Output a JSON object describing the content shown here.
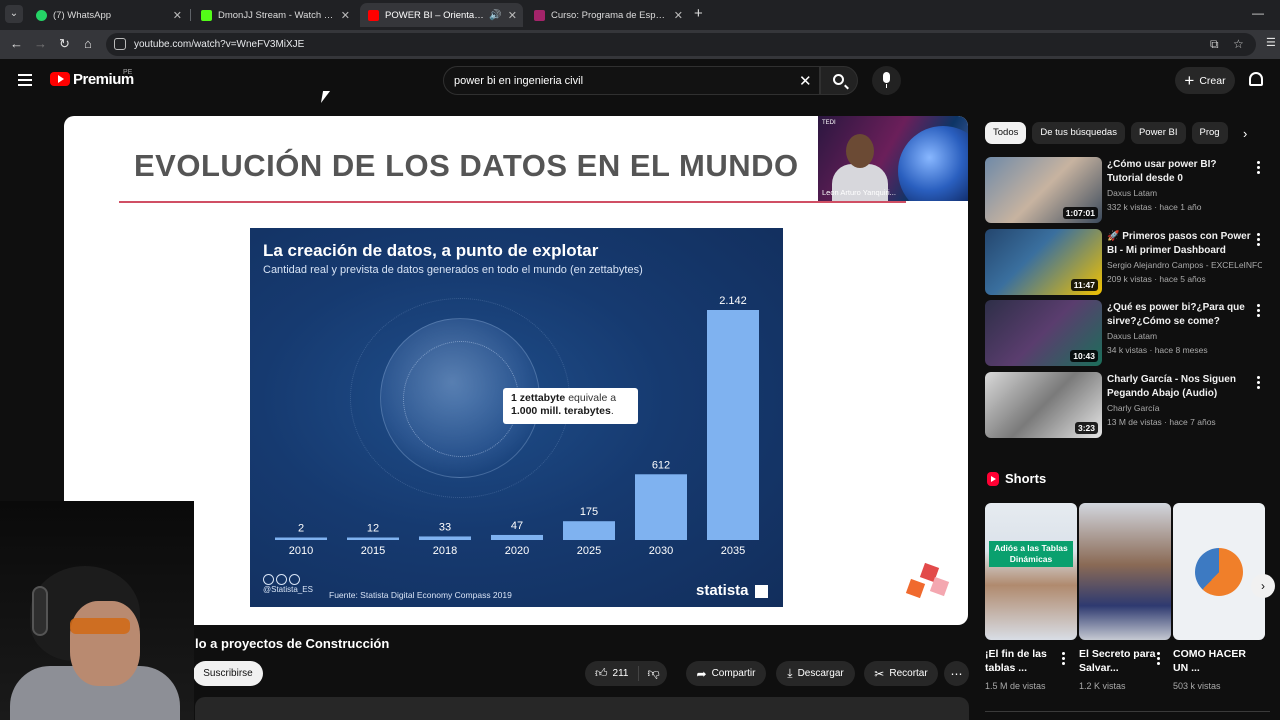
{
  "browser": {
    "tabs": [
      {
        "title": "(7) WhatsApp",
        "favicon_color": "#25d366"
      },
      {
        "title": "DmonJJ Stream - Watch Live on",
        "favicon_color": "#53fc18"
      },
      {
        "title": "POWER BI – Orientado a pro",
        "favicon_color": "#ff0000",
        "active": true
      },
      {
        "title": "Curso: Programa de Especializa",
        "favicon_color": "#a4246a"
      }
    ],
    "url": "youtube.com/watch?v=WneFV3MiXJE"
  },
  "masthead": {
    "logo_text": "Premium",
    "country_code": "PE",
    "search_query": "power bi en ingenieria civil",
    "create_label": "Crear"
  },
  "slide": {
    "title": "EVOLUCIÓN DE LOS DATOS EN EL MUNDO",
    "presenter_name": "Leon Arturo Yanquiri...",
    "presenter_tag": "TEDI"
  },
  "chart_data": {
    "type": "bar",
    "title": "La creación de datos, a punto de explotar",
    "subtitle": "Cantidad real y prevista de datos generados en todo el mundo (en zettabytes)",
    "categories": [
      "2010",
      "2015",
      "2018",
      "2020",
      "2025",
      "2030",
      "2035"
    ],
    "values": [
      2,
      12,
      33,
      47,
      175,
      612,
      2142
    ],
    "value_labels": [
      "2",
      "12",
      "33",
      "47",
      "175",
      "612",
      "2.142"
    ],
    "ylim": [
      0,
      2142
    ],
    "bar_color": "#7fb2f0",
    "grid": false,
    "annotation_bold_1": "1 zettabyte",
    "annotation_rest_1": " equivale a",
    "annotation_bold_2": "1.000 mill. terabytes",
    "annotation_rest_2": ".",
    "license": "@Statista_ES",
    "source": "Fuente: Statista Digital Economy Compass 2019",
    "brand": "statista"
  },
  "video": {
    "title_visible": "lo a proyectos de Construcción",
    "subscribe_label": "Suscribirse",
    "likes": "211",
    "share_label": "Compartir",
    "download_label": "Descargar",
    "clip_label": "Recortar"
  },
  "chips": [
    "Todos",
    "De tus búsquedas",
    "Power BI",
    "Prog"
  ],
  "recommendations": [
    {
      "title": "¿Cómo usar power BI? Tutorial desde 0",
      "channel": "Daxus Latam",
      "meta": "332 k vistas · hace 1 año",
      "duration": "1:07:01",
      "thumb_bg": "#5c6e8a"
    },
    {
      "title": "🚀 Primeros pasos con Power BI - Mi primer Dashboard",
      "channel": "Sergio Alejandro Campos - EXCELeINFO",
      "meta": "209 k vistas · hace 5 años",
      "duration": "11:47",
      "thumb_bg": "#1f3a5a"
    },
    {
      "title": "¿Qué es power bi?¿Para que sirve?¿Cómo se come?",
      "channel": "Daxus Latam",
      "meta": "34 k vistas · hace 8 meses",
      "duration": "10:43",
      "thumb_bg": "#3a3d56"
    },
    {
      "title": "Charly García - Nos Siguen Pegando Abajo (Audio)",
      "channel": "Charly García",
      "meta": "13 M de vistas · hace 7 años",
      "duration": "3:23",
      "thumb_bg": "#b4b4b4"
    }
  ],
  "shorts": {
    "label": "Shorts",
    "items": [
      {
        "title": "¡El fin de las tablas ...",
        "views": "1.5 M de vistas",
        "thumb_bg": "#dfe6ee",
        "overlay": "Adiós a las Tablas Dinámicas"
      },
      {
        "title": "El Secreto para Salvar...",
        "views": "1.2 K vistas",
        "thumb_bg": "#c8ccd6",
        "overlay": ""
      },
      {
        "title": "COMO HACER UN ...",
        "views": "503 k vistas",
        "thumb_bg": "#eef1f4",
        "overlay": ""
      }
    ]
  }
}
